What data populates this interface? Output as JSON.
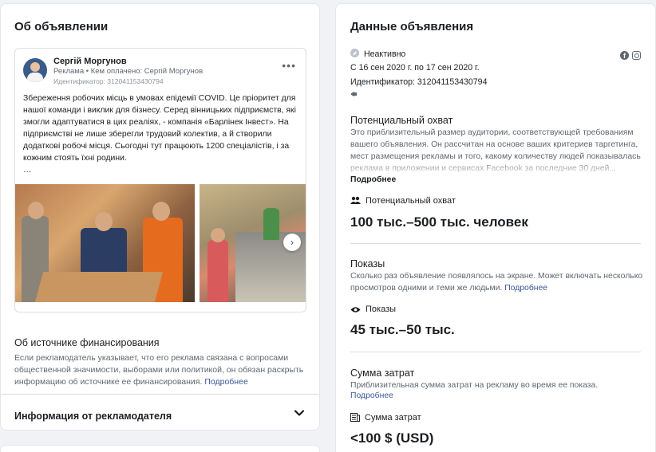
{
  "left": {
    "title": "Об объявлении",
    "preview": {
      "page_name": "Сергій Моргунов",
      "sponsored": "Реклама • Кем оплачено: Сергій Моргунов",
      "ad_id": "Идентификатор: 312041153430794",
      "body": "Збереження робочих місць в умовах епідемії COVID. Це пріоритет для нашої команди і виклик для бізнесу. Серед вінницьких підприємств, які змогли адаптуватися в цих реаліях, - компанія «Барлінек Інвест». На підприємстві не лише зберегли трудовий колектив, а й створили додаткові робочі місця. Сьогодні тут працюють 1200 спеціалістів, і за кожним стоять їхні родини.\n…",
      "more_icon": "more-dots-icon",
      "next_icon": "chevron-right-icon"
    },
    "funding": {
      "title": "Об источнике финансирования",
      "text": "Если рекламодатель указывает, что его реклама связана с вопросами общественной значимости, выборами или политикой, он обязан раскрыть информацию об источнике ее финансирования.",
      "link": "Подробнее"
    },
    "advertiser": {
      "label": "Информация от рекламодателя",
      "icon": "chevron-down-icon"
    }
  },
  "right": {
    "title": "Данные объявления",
    "status": "Неактивно",
    "dates": "С 16 сен 2020 г. по 17 сен 2020 г.",
    "ad_id": "Идентификатор: 312041153430794",
    "platforms": [
      "facebook-icon",
      "instagram-icon"
    ],
    "reach": {
      "heading": "Потенциальный охват",
      "desc": "Это приблизительный размер аудитории, соответствующей требованиям вашего объявления. Он рассчитан на основе ваших критериев таргетинга, мест размещения рекламы и того, какому количеству людей показывалась реклама в приложении и сервисах Facebook за последние 30 дней...",
      "more": "Подробнее",
      "label": "Потенциальный охват",
      "value": "100 тыс.–500 тыс. человек"
    },
    "impressions": {
      "heading": "Показы",
      "desc": "Сколько раз объявление появлялось на экране. Может включать несколько просмотров одними и теми же людьми.",
      "link": "Подробнее",
      "label": "Показы",
      "value": "45 тыс.–50 тыс."
    },
    "spend": {
      "heading": "Сумма затрат",
      "desc": "Приблизительная сумма затрат на рекламу во время ее показа.",
      "link": "Подробнее",
      "label": "Сумма затрат",
      "value": "<100 $ (USD)"
    }
  }
}
